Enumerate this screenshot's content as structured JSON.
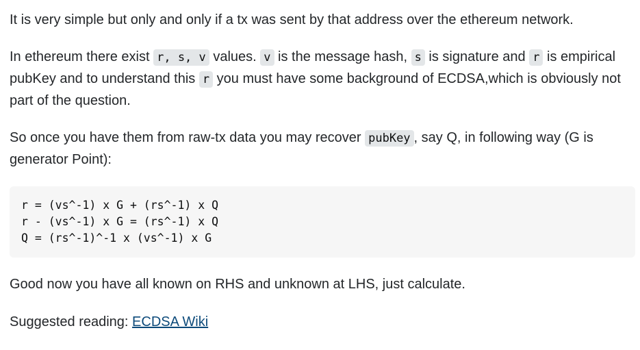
{
  "p1": {
    "text": "It is very simple but only and only if a tx was sent by that address over the ethereum network."
  },
  "p2": {
    "t1": "In ethereum there exist ",
    "c1": "r, s, v",
    "t2": " values. ",
    "c2": "v",
    "t3": " is the message hash, ",
    "c3": "s",
    "t4": " is signature and ",
    "c4": "r",
    "t5": " is empirical pubKey and to understand this ",
    "c5": "r",
    "t6": " you must have some background of ECDSA,which is obviously not part of the question."
  },
  "p3": {
    "t1": "So once you have them from raw-tx data you may recover ",
    "c1": "pubKey",
    "t2": ", say Q, in following way (G is generator Point):"
  },
  "code_block": {
    "lines": [
      "r = (vs^-1) x G + (rs^-1) x Q",
      "r - (vs^-1) x G = (rs^-1) x Q",
      "Q = (rs^-1)^-1 x (vs^-1) x G"
    ]
  },
  "p4": {
    "text": "Good now you have all known on RHS and unknown at LHS, just calculate."
  },
  "p5": {
    "label": "Suggested reading: ",
    "link_text": "ECDSA Wiki"
  }
}
